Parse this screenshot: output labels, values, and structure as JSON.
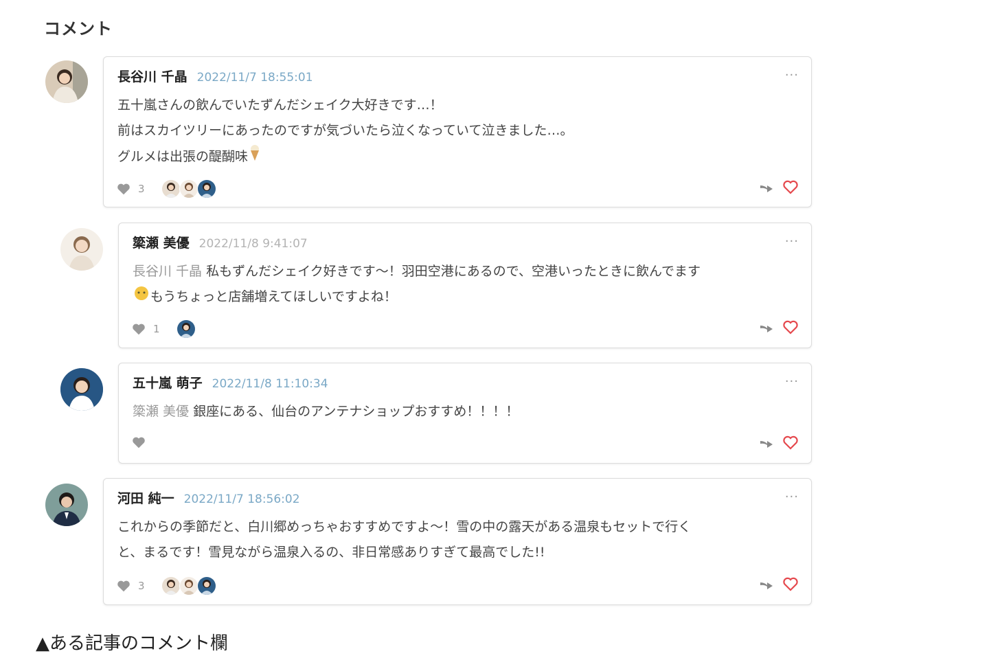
{
  "section_title": "コメント",
  "caption": "▲ある記事のコメント欄",
  "more_label": "···",
  "comments": [
    {
      "name": "長谷川 千晶",
      "time": "2022/11/7 18:55:01",
      "lines": [
        "五十嵐さんの飲んでいたずんだシェイク大好きです…！",
        "前はスカイツリーにあったのですが気づいたら泣くなっていて泣きました…。",
        "グルメは出張の醍醐味"
      ],
      "emoji": "soft-ice-cream-icon",
      "like_count": "3",
      "likers": 3
    },
    {
      "name": "簗瀬 美優",
      "time": "2022/11/8 9:41:07",
      "mention": "長谷川 千晶",
      "text": " 私もずんだシェイク好きです～！羽田空港にあるので、空港いったときに飲んでます",
      "text2": "もうちょっと店舗増えてほしいですよね！",
      "emoji": "face-icon",
      "like_count": "1",
      "likers": 1
    },
    {
      "name": "五十嵐 萌子",
      "time": "2022/11/8 11:10:34",
      "mention": "簗瀬 美優",
      "text": " 銀座にある、仙台のアンテナショップおすすめ！！！！",
      "like_count": "",
      "likers": 0
    },
    {
      "name": "河田 純一",
      "time": "2022/11/7 18:56:02",
      "lines": [
        "これからの季節だと、白川郷めっちゃおすすめですよ～！雪の中の露天がある温泉もセットで行く",
        "と、まるです！雪見ながら温泉入るの、非日常感ありすぎて最高でした!!"
      ],
      "like_count": "3",
      "likers": 3
    }
  ],
  "colors": {
    "timestamp": "#7aa8c6",
    "heart_active": "#e5484d",
    "heart_grey": "#999999",
    "mention": "#999999"
  }
}
